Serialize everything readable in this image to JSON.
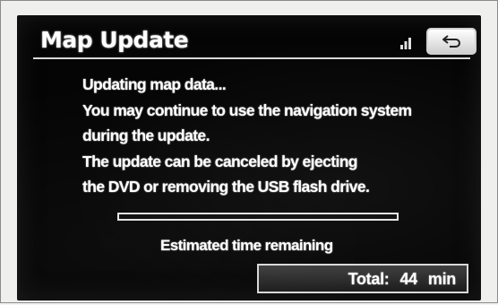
{
  "header": {
    "title": "Map Update",
    "status_icon": "signal-icon",
    "back_icon": "return-arrow-icon"
  },
  "message": {
    "lines": [
      "Updating map data...",
      "You may continue to use the navigation system",
      "during the update.",
      "The update can be canceled by ejecting",
      "the DVD or removing the USB flash drive."
    ]
  },
  "progress": {
    "fraction": 0.0
  },
  "estimate": {
    "label": "Estimated time remaining",
    "total_label": "Total:",
    "total_value": "44",
    "total_unit": "min"
  },
  "colors": {
    "screen": "#050505",
    "text": "#ffffff",
    "button_face": "#e6e6e6"
  }
}
